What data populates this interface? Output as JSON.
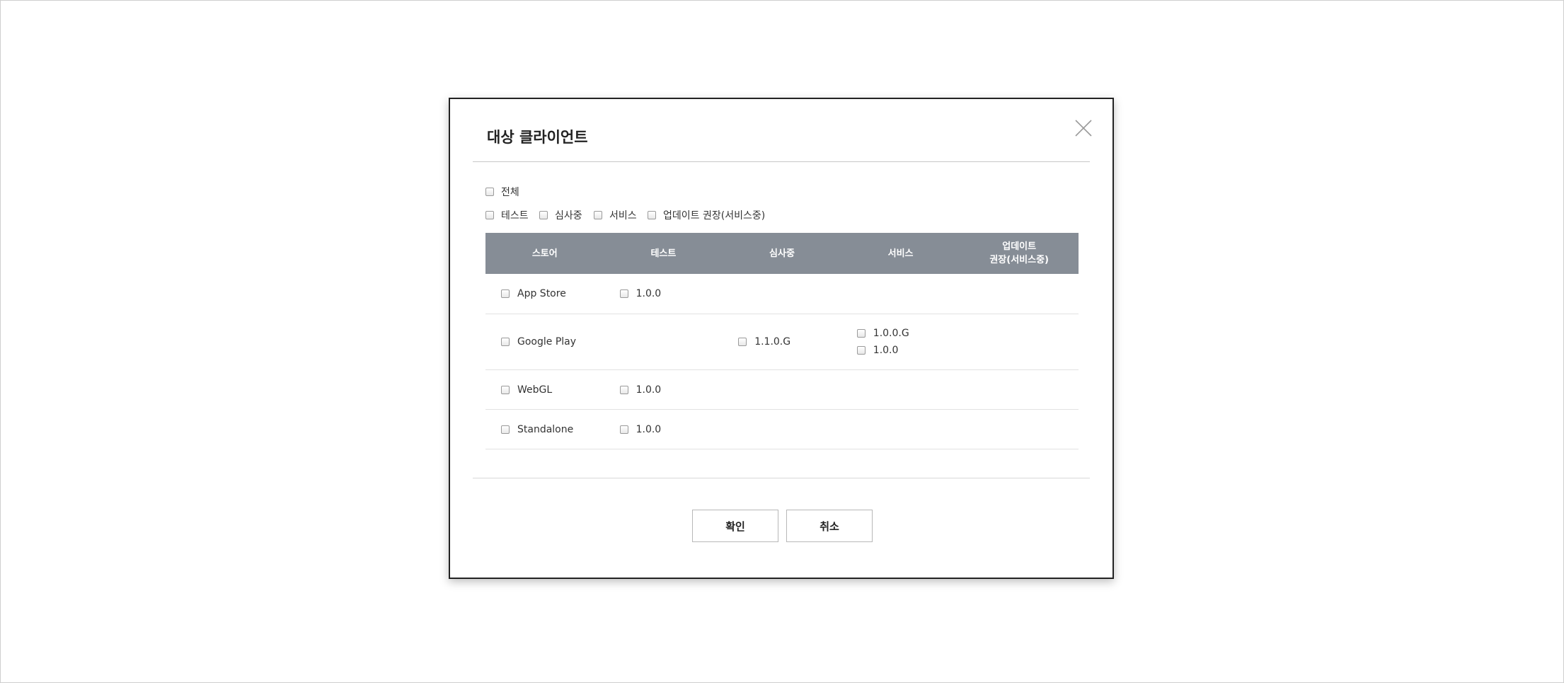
{
  "modal": {
    "title": "대상 클라이언트",
    "close_icon": "close-icon",
    "filters": {
      "all": "전체",
      "options": [
        "테스트",
        "심사중",
        "서비스",
        "업데이트 권장(서비스중)"
      ]
    },
    "table": {
      "headers": [
        "스토어",
        "테스트",
        "심사중",
        "서비스",
        "업데이트\n권장(서비스중)"
      ],
      "rows": [
        {
          "store": "App Store",
          "test": [
            "1.0.0"
          ],
          "review": [],
          "service": [],
          "update": []
        },
        {
          "store": "Google Play",
          "test": [],
          "review": [
            "1.1.0.G"
          ],
          "service": [
            "1.0.0.G",
            "1.0.0"
          ],
          "update": []
        },
        {
          "store": "WebGL",
          "test": [
            "1.0.0"
          ],
          "review": [],
          "service": [],
          "update": []
        },
        {
          "store": "Standalone",
          "test": [
            "1.0.0"
          ],
          "review": [],
          "service": [],
          "update": []
        }
      ]
    },
    "buttons": {
      "confirm": "확인",
      "cancel": "취소"
    }
  },
  "colors": {
    "header_bg": "#868d96",
    "border": "#222222"
  }
}
